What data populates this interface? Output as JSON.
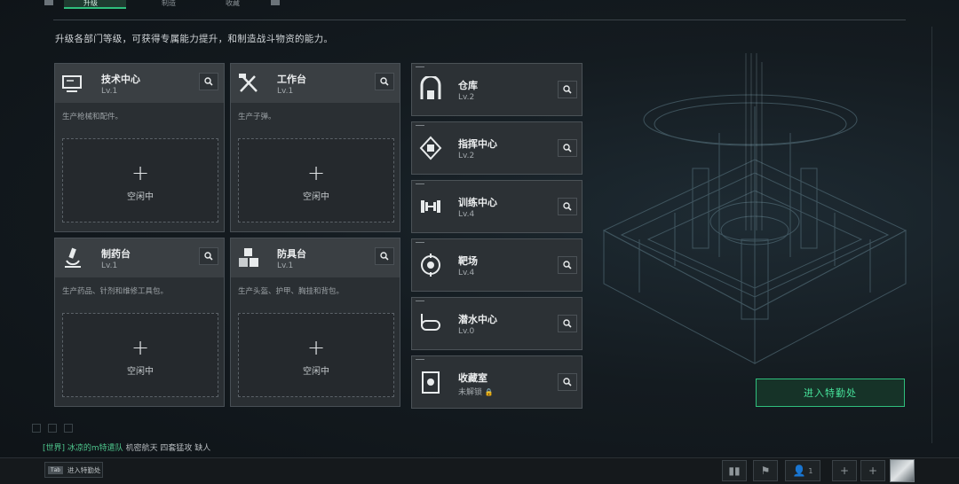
{
  "nav": {
    "tabs": [
      {
        "label": "升级",
        "active": true
      },
      {
        "label": "制造",
        "active": false
      },
      {
        "label": "收藏",
        "active": false
      }
    ]
  },
  "subtitle": "升级各部门等级，可获得专属能力提升，和制造战斗物资的能力。",
  "production_cards": [
    {
      "name": "技术中心",
      "level": "Lv.1",
      "desc": "生产枪械和配件。",
      "slot_status": "空闲中",
      "icon": "monitor-icon"
    },
    {
      "name": "工作台",
      "level": "Lv.1",
      "desc": "生产子弹。",
      "slot_status": "空闲中",
      "icon": "tools-icon"
    },
    {
      "name": "制药台",
      "level": "Lv.1",
      "desc": "生产药品、针剂和维修工具包。",
      "slot_status": "空闲中",
      "icon": "microscope-icon"
    },
    {
      "name": "防具台",
      "level": "Lv.1",
      "desc": "生产头盔、护甲、胸挂和背包。",
      "slot_status": "空闲中",
      "icon": "boxes-icon"
    }
  ],
  "facilities": [
    {
      "name": "仓库",
      "level": "Lv.2",
      "icon": "warehouse-icon"
    },
    {
      "name": "指挥中心",
      "level": "Lv.2",
      "icon": "chip-icon"
    },
    {
      "name": "训练中心",
      "level": "Lv.4",
      "icon": "dumbbell-icon"
    },
    {
      "name": "靶场",
      "level": "Lv.4",
      "icon": "target-icon"
    },
    {
      "name": "潜水中心",
      "level": "Lv.0",
      "icon": "diving-mask-icon"
    },
    {
      "name": "收藏室",
      "level": "未解锁",
      "locked": true,
      "icon": "collection-icon"
    }
  ],
  "enter_button": "进入特勤处",
  "chat": {
    "channel": "[世界]",
    "sender": "冰凉的m特遣队",
    "message": "机密航天  四套猛攻 缺人"
  },
  "bottom": {
    "tab_key": "Tab",
    "tab_label": "进入特勤处",
    "friends_count": "1"
  },
  "colors": {
    "accent": "#2fbf7d",
    "panel": "#2a2f33",
    "background": "#141b20"
  }
}
